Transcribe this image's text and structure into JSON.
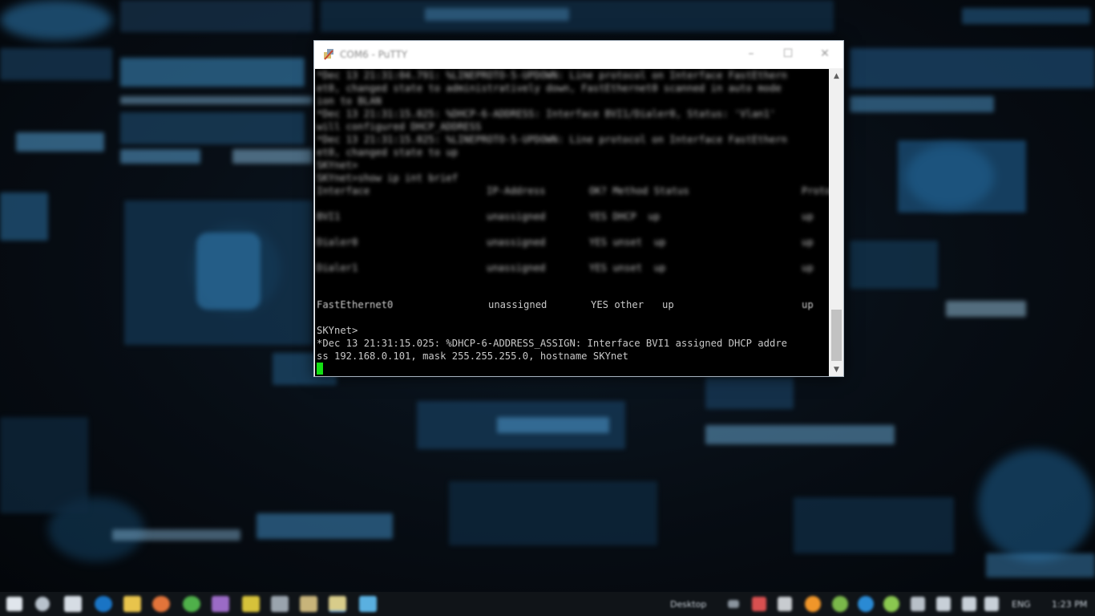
{
  "window": {
    "title": "COM6 - PuTTY",
    "buttons": {
      "minimize": "–",
      "maximize": "☐",
      "close": "✕"
    }
  },
  "terminal": {
    "blurred_lines": [
      "*Dec 13 21:31:04.791: %LINEPROTO-5-UPDOWN: Line protocol on Interface FastEthern",
      "et0, changed state to administratively down, FastEthernet0 scanned in auto mode",
      "ion to BLAN",
      "*Dec 13 21:31:15.025: %DHCP-6-ADDRESS: Interface BVI1/Dialer0, Status: 'Vlan1'",
      "will configured DHCP_ADDRESS",
      "*Dec 13 21:31:15.025: %LINEPROTO-5-UPDOWN: Line protocol on Interface FastEthern",
      "et0, changed state to up",
      "SKYnet>",
      "SKYnet>show ip int brief"
    ],
    "table_header": [
      "Interface",
      "IP-Address",
      "OK? Method Status",
      "Protocol"
    ],
    "blurred_rows": [
      [
        "BVI1",
        "unassigned",
        "YES DHCP  up",
        "up"
      ],
      [
        "Dialer0",
        "unassigned",
        "YES unset  up",
        "up"
      ],
      [
        "Dialer1",
        "unassigned",
        "YES unset  up",
        "up"
      ]
    ],
    "visible_row": {
      "interface": "FastEthernet0",
      "ip": "unassigned",
      "ok_method": "YES other",
      "status": "up",
      "protocol": "up"
    },
    "prompt": "SKYnet>",
    "log_line_1": "*Dec 13 21:31:15.025: %DHCP-6-ADDRESS_ASSIGN: Interface BVI1 assigned DHCP addre",
    "log_line_2": "ss 192.168.0.101, mask 255.255.255.0, hostname SKYnet"
  },
  "taskbar": {
    "desktop_label": "Desktop",
    "lang": "ENG",
    "clock": "1:23 PM"
  },
  "colors": {
    "cursor": "#14e014",
    "terminal_bg": "#000000",
    "terminal_fg": "#c8c8c8",
    "wallpaper_accent": "#2f8ccc"
  }
}
